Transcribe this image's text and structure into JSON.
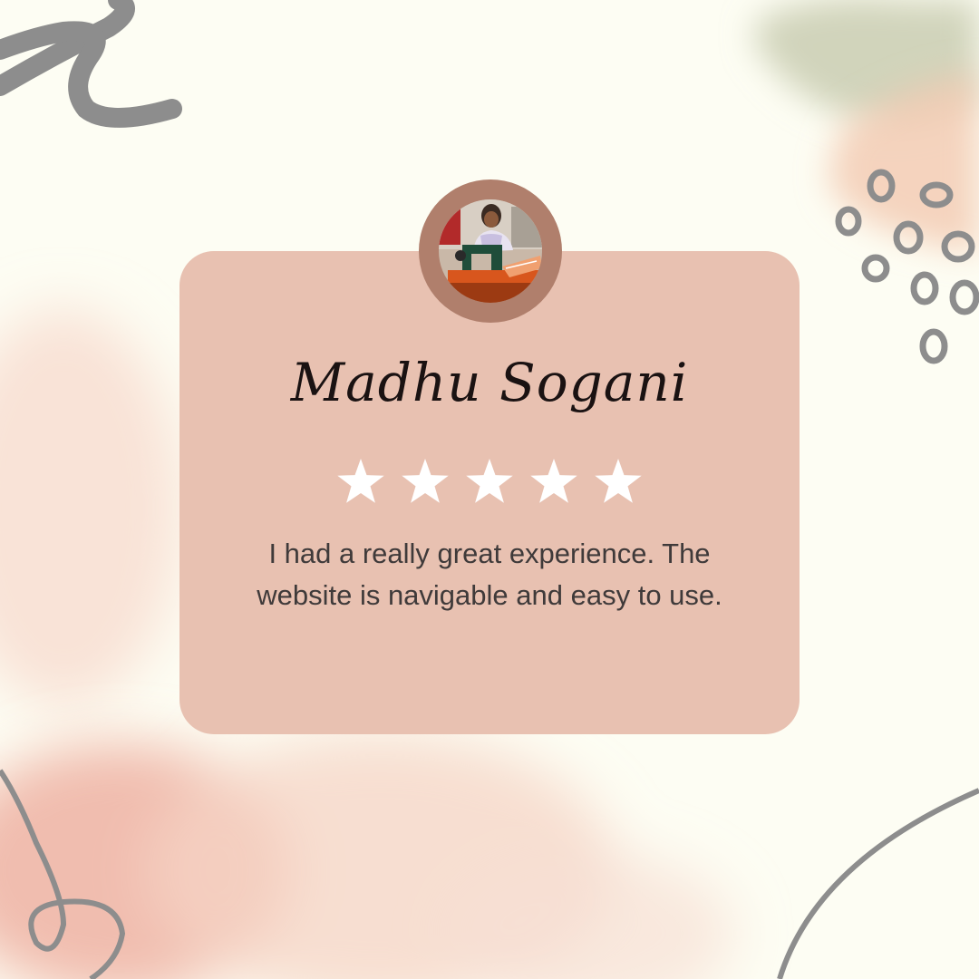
{
  "review": {
    "name": "Madhu Sogani",
    "rating": 5,
    "rating_max": 5,
    "text": "I had a really great experience. The website is navigable and easy to use."
  },
  "colors": {
    "background": "#fdfdf3",
    "card": "#e8c1b1",
    "avatar_ring": "#b07f6c",
    "star": "#ffffff",
    "text": "#3f3a3a",
    "name": "#1a1212",
    "scribble": "#8a8a8a"
  },
  "icons": {
    "star": "star-icon",
    "avatar": "seamstress-photo"
  }
}
